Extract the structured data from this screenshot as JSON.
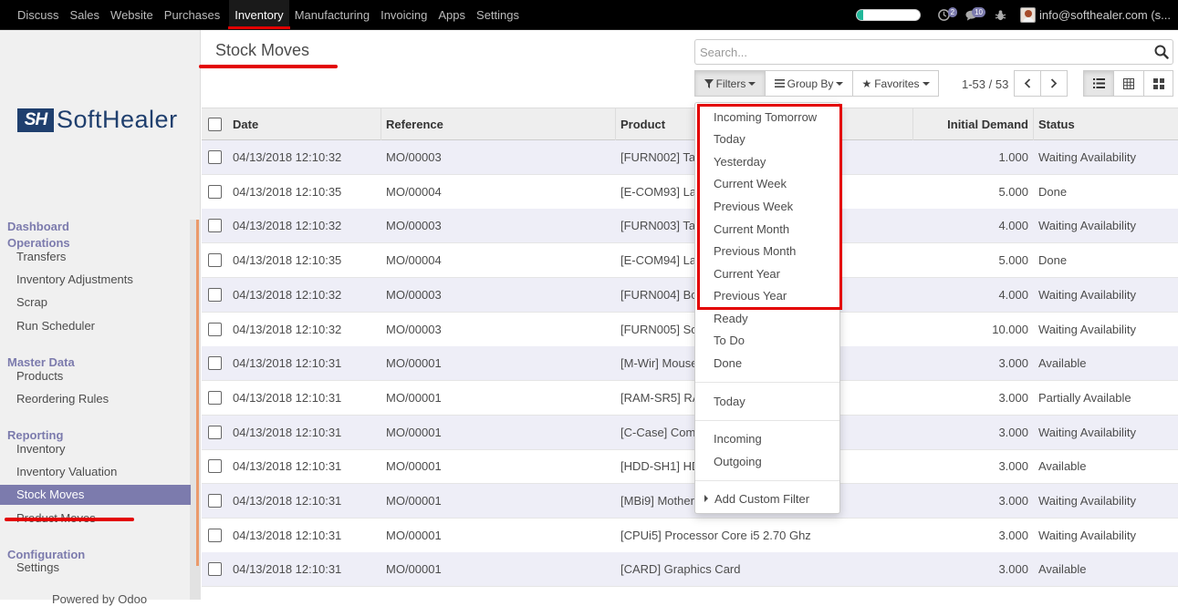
{
  "topbar": {
    "menu": [
      "Discuss",
      "Sales",
      "Website",
      "Purchases",
      "Inventory",
      "Manufacturing",
      "Invoicing",
      "Apps",
      "Settings"
    ],
    "active": "Inventory",
    "progress_fraction": 0.1,
    "chat_count": "2",
    "message_count": "10",
    "user": "info@softhealer.com (s..."
  },
  "sidebar": {
    "logo_mark": "SH",
    "logo_text": "SoftHealer",
    "sections": [
      {
        "title": "Dashboard",
        "items": []
      },
      {
        "title": "Operations",
        "items": [
          "Transfers",
          "Inventory Adjustments",
          "Scrap",
          "Run Scheduler"
        ]
      },
      {
        "title": "Master Data",
        "items": [
          "Products",
          "Reordering Rules"
        ]
      },
      {
        "title": "Reporting",
        "items": [
          "Inventory",
          "Inventory Valuation",
          "Stock Moves",
          "Product Moves"
        ]
      },
      {
        "title": "Configuration",
        "items": [
          "Settings"
        ]
      }
    ],
    "active_item": "Stock Moves",
    "footer": "Powered by Odoo"
  },
  "page": {
    "title": "Stock Moves",
    "search_placeholder": "Search...",
    "filters_label": "Filters",
    "groupby_label": "Group By",
    "favorites_label": "Favorites",
    "pager": "1-53 / 53"
  },
  "table": {
    "columns": [
      "Date",
      "Reference",
      "Product",
      "Initial Demand",
      "Status"
    ],
    "rows": [
      [
        "04/13/2018 12:10:32",
        "MO/00003",
        "[FURN002] Ta",
        "1.000",
        "Waiting Availability"
      ],
      [
        "04/13/2018 12:10:35",
        "MO/00004",
        "[E-COM93] La",
        "5.000",
        "Done"
      ],
      [
        "04/13/2018 12:10:32",
        "MO/00003",
        "[FURN003] Ta",
        "4.000",
        "Waiting Availability"
      ],
      [
        "04/13/2018 12:10:35",
        "MO/00004",
        "[E-COM94] La",
        "5.000",
        "Done"
      ],
      [
        "04/13/2018 12:10:32",
        "MO/00003",
        "[FURN004] Bo",
        "4.000",
        "Waiting Availability"
      ],
      [
        "04/13/2018 12:10:32",
        "MO/00003",
        "[FURN005] So",
        "10.000",
        "Waiting Availability"
      ],
      [
        "04/13/2018 12:10:31",
        "MO/00001",
        "[M-Wir] Mouse",
        "3.000",
        "Available"
      ],
      [
        "04/13/2018 12:10:31",
        "MO/00001",
        "[RAM-SR5] RA",
        "3.000",
        "Partially Available"
      ],
      [
        "04/13/2018 12:10:31",
        "MO/00001",
        "[C-Case] Com",
        "3.000",
        "Waiting Availability"
      ],
      [
        "04/13/2018 12:10:31",
        "MO/00001",
        "[HDD-SH1] HD",
        "3.000",
        "Available"
      ],
      [
        "04/13/2018 12:10:31",
        "MO/00001",
        "[MBi9] Mother",
        "3.000",
        "Waiting Availability"
      ],
      [
        "04/13/2018 12:10:31",
        "MO/00001",
        "[CPUi5] Processor Core i5 2.70 Ghz",
        "3.000",
        "Waiting Availability"
      ],
      [
        "04/13/2018 12:10:31",
        "MO/00001",
        "[CARD] Graphics Card",
        "3.000",
        "Available"
      ]
    ]
  },
  "filters_menu": {
    "date_filters": [
      "Incoming Tomorrow",
      "Today",
      "Yesterday",
      "Current Week",
      "Previous Week",
      "Current Month",
      "Previous Month",
      "Current Year",
      "Previous Year"
    ],
    "state_filters": [
      "Ready",
      "To Do",
      "Done"
    ],
    "other_filters": [
      "Today"
    ],
    "direction_filters": [
      "Incoming",
      "Outgoing"
    ],
    "custom": "Add Custom Filter"
  }
}
